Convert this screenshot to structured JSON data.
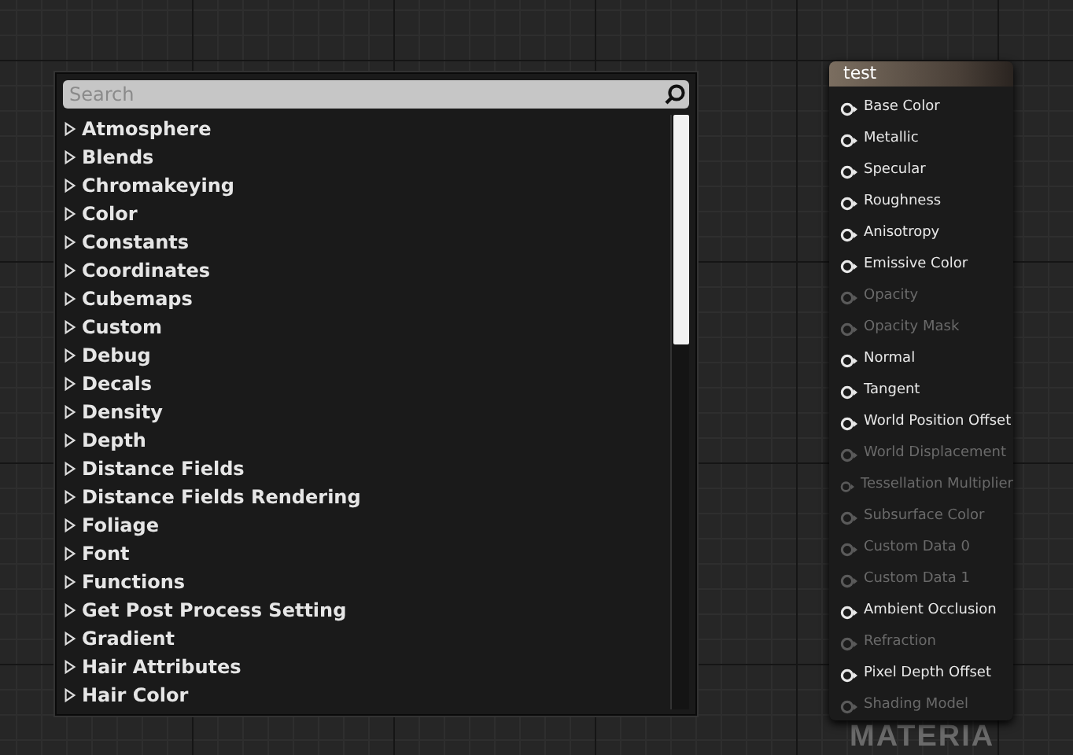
{
  "graph_label": "MATERIA",
  "action_menu": {
    "search": {
      "placeholder": "Search"
    },
    "categories": [
      {
        "label": "Atmosphere",
        "expanded": false
      },
      {
        "label": "Blends",
        "expanded": false
      },
      {
        "label": "Chromakeying",
        "expanded": false
      },
      {
        "label": "Color",
        "expanded": false
      },
      {
        "label": "Constants",
        "expanded": false
      },
      {
        "label": "Coordinates",
        "expanded": false
      },
      {
        "label": "Cubemaps",
        "expanded": false
      },
      {
        "label": "Custom",
        "expanded": false
      },
      {
        "label": "Debug",
        "expanded": false
      },
      {
        "label": "Decals",
        "expanded": false
      },
      {
        "label": "Density",
        "expanded": false
      },
      {
        "label": "Depth",
        "expanded": false
      },
      {
        "label": "Distance Fields",
        "expanded": false
      },
      {
        "label": "Distance Fields Rendering",
        "expanded": false
      },
      {
        "label": "Foliage",
        "expanded": false
      },
      {
        "label": "Font",
        "expanded": false
      },
      {
        "label": "Functions",
        "expanded": false
      },
      {
        "label": "Get Post Process Setting",
        "expanded": false
      },
      {
        "label": "Gradient",
        "expanded": false
      },
      {
        "label": "Hair Attributes",
        "expanded": false
      },
      {
        "label": "Hair Color",
        "expanded": false
      }
    ]
  },
  "node": {
    "title": "test",
    "pins": [
      {
        "label": "Base Color",
        "disabled": false
      },
      {
        "label": "Metallic",
        "disabled": false
      },
      {
        "label": "Specular",
        "disabled": false
      },
      {
        "label": "Roughness",
        "disabled": false
      },
      {
        "label": "Anisotropy",
        "disabled": false
      },
      {
        "label": "Emissive Color",
        "disabled": false
      },
      {
        "label": "Opacity",
        "disabled": true
      },
      {
        "label": "Opacity Mask",
        "disabled": true
      },
      {
        "label": "Normal",
        "disabled": false
      },
      {
        "label": "Tangent",
        "disabled": false
      },
      {
        "label": "World Position Offset",
        "disabled": false
      },
      {
        "label": "World Displacement",
        "disabled": true
      },
      {
        "label": "Tessellation Multiplier",
        "disabled": true
      },
      {
        "label": "Subsurface Color",
        "disabled": true
      },
      {
        "label": "Custom Data 0",
        "disabled": true
      },
      {
        "label": "Custom Data 1",
        "disabled": true
      },
      {
        "label": "Ambient Occlusion",
        "disabled": false
      },
      {
        "label": "Refraction",
        "disabled": true
      },
      {
        "label": "Pixel Depth Offset",
        "disabled": false
      },
      {
        "label": "Shading Model",
        "disabled": true
      }
    ]
  }
}
